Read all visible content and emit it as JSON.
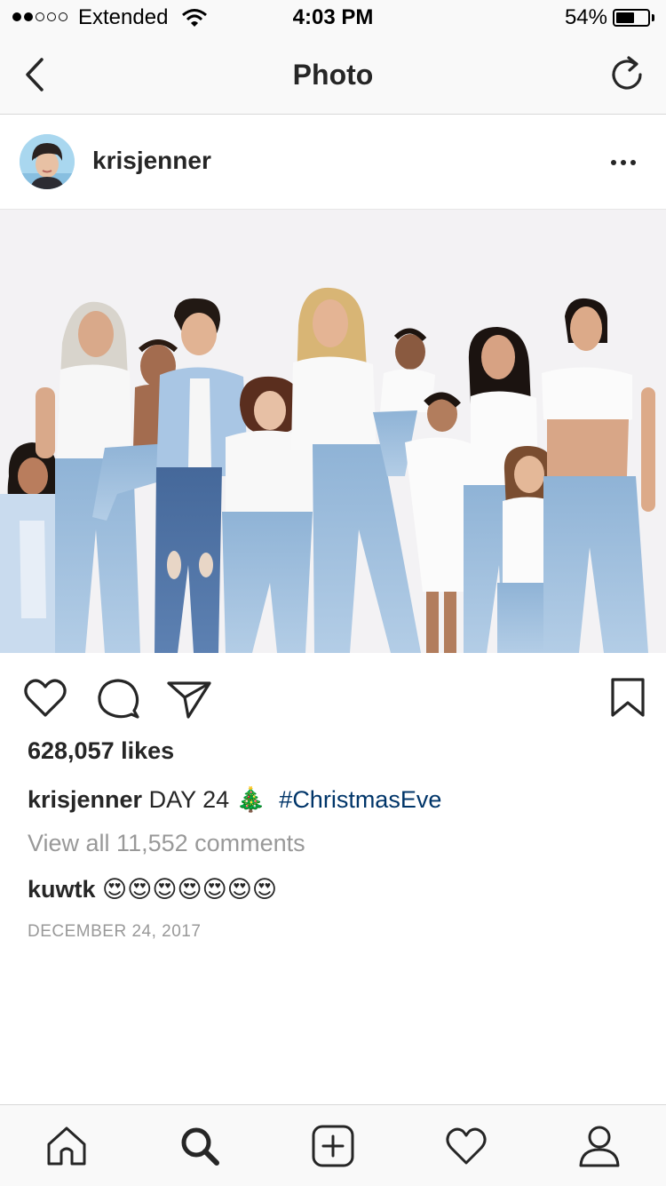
{
  "status_bar": {
    "carrier": "Extended",
    "signal_bars_filled": 2,
    "signal_bars_total": 5,
    "time": "4:03 PM",
    "battery_percent": "54%",
    "battery_level": 0.54
  },
  "nav": {
    "title": "Photo",
    "back_icon": "chevron-left-icon",
    "refresh_icon": "refresh-icon"
  },
  "post": {
    "username": "krisjenner",
    "photo_description": "Family group photo in white tops and denim jeans",
    "likes": "628,057 likes",
    "caption": {
      "username": "krisjenner",
      "text": "DAY 24 🎄",
      "hashtag": "#ChristmasEve"
    },
    "view_comments": "View all 11,552 comments",
    "comment": {
      "username": "kuwtk",
      "text": "😍😍😍😍😍😍😍"
    },
    "date": "DECEMBER 24, 2017"
  },
  "tabs": [
    "home-icon",
    "search-icon",
    "add-post-icon",
    "activity-heart-icon",
    "profile-icon"
  ],
  "colors": {
    "text": "#262626",
    "muted": "#999999",
    "hashtag": "#003569",
    "bar_background": "#f9f9f9"
  }
}
